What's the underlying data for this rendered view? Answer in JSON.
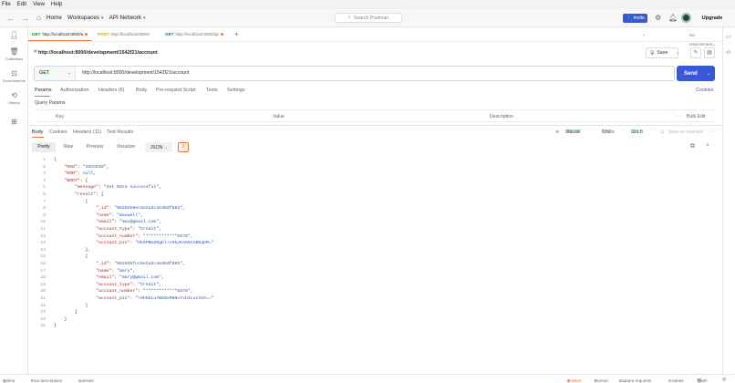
{
  "menubar": [
    "File",
    "Edit",
    "View",
    "Help"
  ],
  "topbar": {
    "home": "Home",
    "workspaces": "Workspaces",
    "api_network": "API Network",
    "search_placeholder": "Search Postman",
    "invite": "Invite",
    "upgrade": "Upgrade"
  },
  "sidebar": {
    "items": [
      {
        "label": "",
        "icon": "user-icon"
      },
      {
        "label": "Collections",
        "icon": "collections-icon"
      },
      {
        "label": "Environments",
        "icon": "environments-icon"
      },
      {
        "label": "History",
        "icon": "history-icon"
      },
      {
        "label": "",
        "icon": "apps-icon"
      }
    ]
  },
  "tabs": [
    {
      "method": "GET",
      "label": "http://localhost:8000/a",
      "active": true,
      "dirty": true
    },
    {
      "method": "POST",
      "label": "http://localhost:8000/",
      "active": false,
      "dirty": false
    },
    {
      "method": "GET",
      "label": "http://localhost:8000/ap",
      "active": false,
      "dirty": true
    }
  ],
  "environment": "No environment",
  "request": {
    "title": "http://localhost:8000/development/1542f21/account",
    "method": "GET",
    "url": "http://localhost:8000/development/1542f21/account",
    "save": "Save",
    "send": "Send"
  },
  "request_tabs": {
    "params": "Params",
    "authorization": "Authorization",
    "headers": "Headers (6)",
    "body": "Body",
    "pre_request": "Pre-request Script",
    "tests": "Tests",
    "settings": "Settings",
    "cookies": "Cookies"
  },
  "query_params": {
    "title": "Query Params",
    "key": "Key",
    "value": "Value",
    "description": "Description",
    "bulk_edit": "Bulk Edit"
  },
  "response_tabs": {
    "body": "Body",
    "cookies": "Cookies",
    "headers": "Headers (11)",
    "test_results": "Test Results"
  },
  "response_status": {
    "status_label": "Status:",
    "status_value": "200 OK",
    "time_label": "Time:",
    "time_value": "6.52 s",
    "size_label": "Size:",
    "size_value": "821 B",
    "save_example": "Save as example"
  },
  "format": {
    "pretty": "Pretty",
    "raw": "Raw",
    "preview": "Preview",
    "visualize": "Visualize",
    "json": "JSON"
  },
  "code_lines": [
    "{",
    "    \"MSG\": \"SUCCESS\",",
    "    \"ERR\": null,",
    "    \"BODY\": {",
    "        \"message\": \"Get Data successful\",",
    "        \"result\": [",
    "            {",
    "                \"_id\": \"66292b9ec6e2a3c4ed6df683\",",
    "                \"name\": \"maxwell\",",
    "                \"email\": \"max@gmail.com\",",
    "                \"account_type\": \"Credit\",",
    "                \"account_number\": \"************5678\",",
    "                \"account_pin\": \"HkbPBm29gbl+cOkyKA55cAB5qbM=\"",
    "            },",
    "            {",
    "                \"_id\": \"66292bfcc6e2a3c4ed6df685\",",
    "                \"name\": \"mary\",",
    "                \"email\": \"mary@gmail.com\",",
    "                \"account_type\": \"Credit\",",
    "                \"account_number\": \"************5678\",",
    "                \"account_pin\": \"+OhG8Lo7WGNxM0NoYxbILoczUA==\"",
    "            }",
    "        ]",
    "    }",
    "}"
  ],
  "statusbar": {
    "online": "Online",
    "find_replace": "Find and replace",
    "console": "Console",
    "postbot": "Postbot",
    "runner": "Runner",
    "capture": "Capture requests",
    "cookies": "Cookies",
    "trash": "Trash"
  },
  "colors": {
    "accent": "#e8793b",
    "brand": "#3a57d4",
    "success": "#217a3b"
  }
}
